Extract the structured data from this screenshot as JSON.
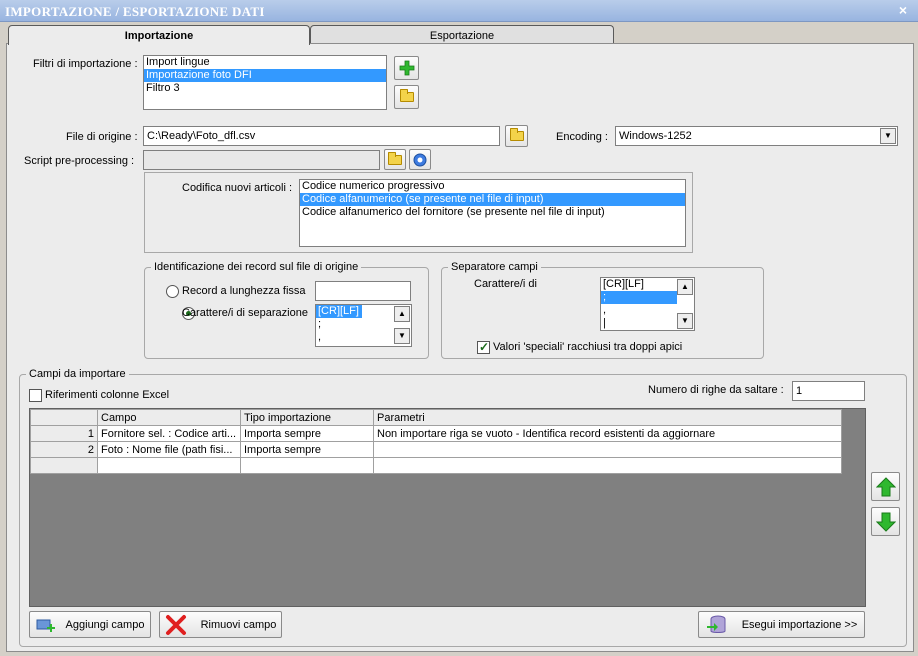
{
  "window": {
    "title": "IMPORTAZIONE / ESPORTAZIONE DATI",
    "close": "×"
  },
  "tabs": [
    {
      "label": "Importazione"
    },
    {
      "label": "Esportazione"
    }
  ],
  "filters": {
    "label": "Filtri di importazione :",
    "items": [
      "Import lingue",
      "Importazione foto DFI",
      "Filtro 3"
    ],
    "selected_index": 1
  },
  "source_file": {
    "label": "File di origine :",
    "value": "C:\\Ready\\Foto_dfl.csv"
  },
  "encoding": {
    "label": "Encoding :",
    "value": "Windows-1252"
  },
  "script": {
    "label": "Script pre-processing :",
    "value": ""
  },
  "coding": {
    "label": "Codifica nuovi articoli :",
    "items": [
      "Codice numerico progressivo",
      "Codice alfanumerico (se presente nel file di input)",
      "Codice alfanumerico del fornitore (se presente nel file di input)"
    ],
    "selected_index": 1
  },
  "record_id": {
    "title": "Identificazione dei record sul file di origine",
    "option_fixed": "Record a lunghezza fissa",
    "option_sep": "Carattere/i di separazione",
    "fixed_value": "",
    "sep_items": [
      "[CR][LF]",
      ";",
      ","
    ]
  },
  "field_sep": {
    "title": "Separatore campi",
    "label": "Carattere/i di",
    "items": [
      "[CR][LF]",
      ";",
      ",",
      "|"
    ],
    "checkbox": "Valori 'speciali' racchiusi tra doppi apici"
  },
  "fields": {
    "title": "Campi da importare",
    "excel_refs": "Riferimenti colonne Excel",
    "skip_label": "Numero di righe da saltare :",
    "skip_value": "1",
    "columns": [
      "Campo",
      "Tipo importazione",
      "Parametri"
    ],
    "rows": [
      {
        "n": "1",
        "campo": "Fornitore sel. : Codice arti...",
        "tipo": "Importa sempre",
        "param": "Non importare riga se vuoto - Identifica record esistenti da aggiornare"
      },
      {
        "n": "2",
        "campo": "Foto : Nome file (path fisi...",
        "tipo": "Importa sempre",
        "param": ""
      }
    ]
  },
  "buttons": {
    "add": "Aggiungi campo",
    "remove": "Rimuovi campo",
    "run": "Esegui importazione >>"
  },
  "colors": {
    "title_bar": "#a9c0e6",
    "selection": "#3399ff",
    "grid_bg": "#808080",
    "arrow_green": "#2fb82f"
  }
}
